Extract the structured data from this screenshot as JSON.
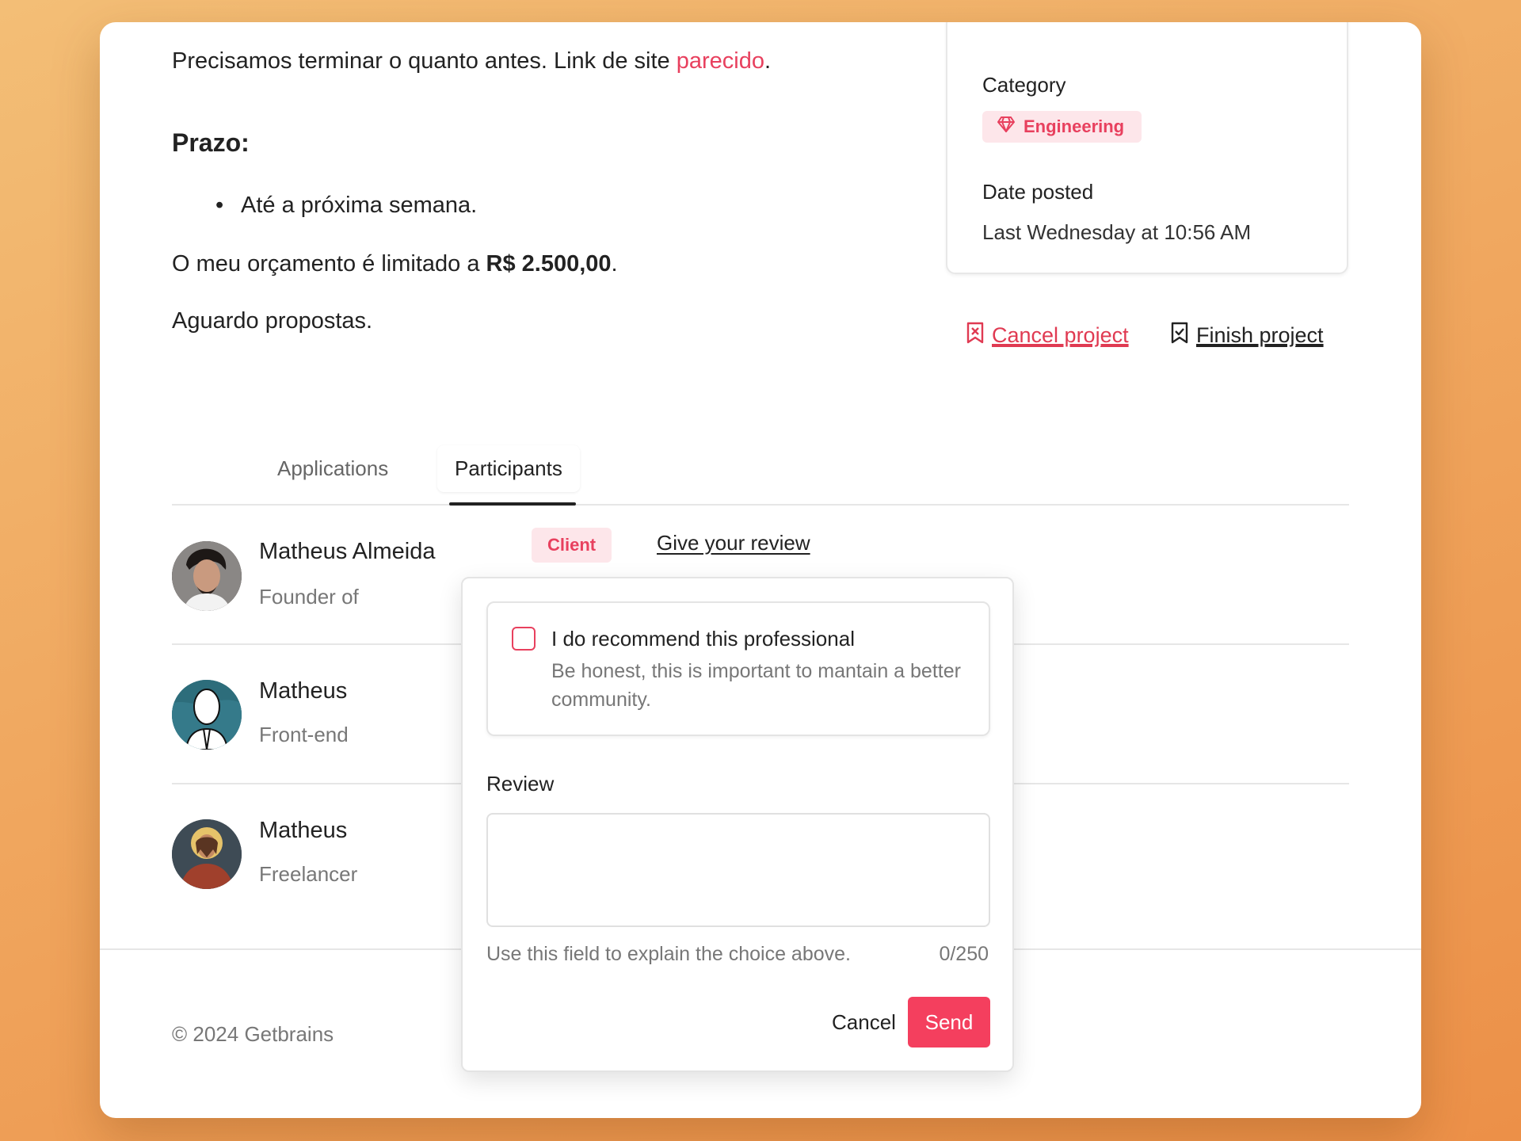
{
  "description": {
    "intro_text": "Precisamos terminar o quanto antes. Link de site ",
    "intro_link": "parecido",
    "intro_end": ".",
    "deadline_heading": "Prazo:",
    "deadline_items": [
      "Até a próxima semana."
    ],
    "budget_text": "O meu orçamento é limitado a ",
    "budget_value": "R$ 2.500,00",
    "budget_end": ".",
    "closing": "Aguardo propostas."
  },
  "sidebar": {
    "category_label": "Category",
    "category_value": "Engineering",
    "category_icon": "diamond-icon",
    "date_label": "Date posted",
    "date_value": "Last Wednesday at 10:56 AM"
  },
  "actions": {
    "cancel_label": "Cancel project",
    "finish_label": "Finish project"
  },
  "tabs": [
    {
      "label": "Applications",
      "active": false
    },
    {
      "label": "Participants",
      "active": true
    }
  ],
  "participants": [
    {
      "name": "Matheus Almeida",
      "role": "Founder of",
      "badge": "Client",
      "review_link": "Give your review"
    },
    {
      "name": "Matheus",
      "role": "Front-end"
    },
    {
      "name": "Matheus",
      "role": "Freelancer"
    }
  ],
  "footer": {
    "copyright": "© 2024 Getbrains"
  },
  "review_popover": {
    "recommend_label": "I do recommend this professional",
    "recommend_help": "Be honest, this is important to mantain a better community.",
    "review_label": "Review",
    "review_value": "",
    "hint": "Use this field to explain the choice above.",
    "counter": "0/250",
    "cancel_label": "Cancel",
    "send_label": "Send"
  },
  "colors": {
    "accent": "#f43f5e",
    "accent_text": "#e8405e",
    "badge_bg": "#fde6ea"
  }
}
